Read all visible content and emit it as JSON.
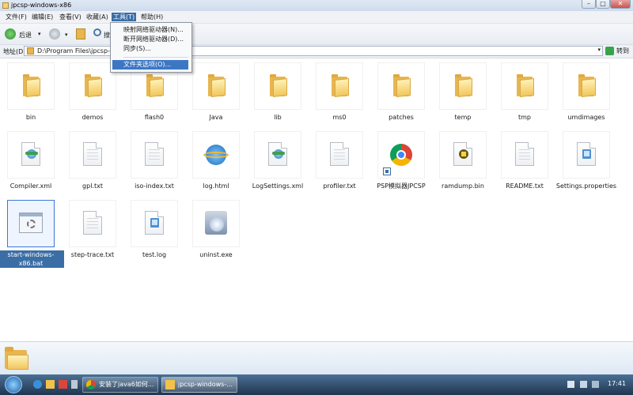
{
  "window": {
    "title": "jpcsp-windows-x86"
  },
  "menubar": {
    "items": [
      "文件(F)",
      "编辑(E)",
      "查看(V)",
      "收藏(A)",
      "工具(T)",
      "帮助(H)"
    ],
    "active": "工具(T)"
  },
  "tools_menu": {
    "items": [
      "映射网络驱动器(N)...",
      "断开网络驱动器(D)...",
      "同步(S)...",
      "文件夹选项(O)..."
    ],
    "highlighted": "文件夹选项(O)..."
  },
  "toolbar": {
    "back_label": "后退",
    "search_label_partial": "搜"
  },
  "address": {
    "label": "地址(D)",
    "value": "D:\\Program Files\\jpcsp-wi",
    "go_label": "转到"
  },
  "files": [
    {
      "name": "bin",
      "type": "folder"
    },
    {
      "name": "demos",
      "type": "folder"
    },
    {
      "name": "flash0",
      "type": "folder"
    },
    {
      "name": "Java",
      "type": "folder"
    },
    {
      "name": "lib",
      "type": "folder"
    },
    {
      "name": "ms0",
      "type": "folder"
    },
    {
      "name": "patches",
      "type": "folder"
    },
    {
      "name": "temp",
      "type": "folder"
    },
    {
      "name": "tmp",
      "type": "folder"
    },
    {
      "name": "umdimages",
      "type": "folder"
    },
    {
      "name": "Compiler.xml",
      "type": "xml"
    },
    {
      "name": "gpl.txt",
      "type": "text"
    },
    {
      "name": "iso-index.txt",
      "type": "text"
    },
    {
      "name": "log.html",
      "type": "ie"
    },
    {
      "name": "LogSettings.xml",
      "type": "xml"
    },
    {
      "name": "profiler.txt",
      "type": "text"
    },
    {
      "name": "PSP模拟器JPCSP",
      "type": "chrome"
    },
    {
      "name": "ramdump.bin",
      "type": "bin"
    },
    {
      "name": "README.txt",
      "type": "text"
    },
    {
      "name": "Settings.properties",
      "type": "props"
    },
    {
      "name": "start-windows-x86.bat",
      "type": "bat",
      "selected": true
    },
    {
      "name": "step-trace.txt",
      "type": "text"
    },
    {
      "name": "test.log",
      "type": "props"
    },
    {
      "name": "uninst.exe",
      "type": "exe"
    }
  ],
  "taskbar": {
    "tasks": [
      "安装了java6如何...",
      "jpcsp-windows-..."
    ],
    "time": "17:41"
  },
  "colors": {
    "selection": "#3a6ea5",
    "menu_highlight": "#3d77c4",
    "taskbar": "#203650"
  }
}
